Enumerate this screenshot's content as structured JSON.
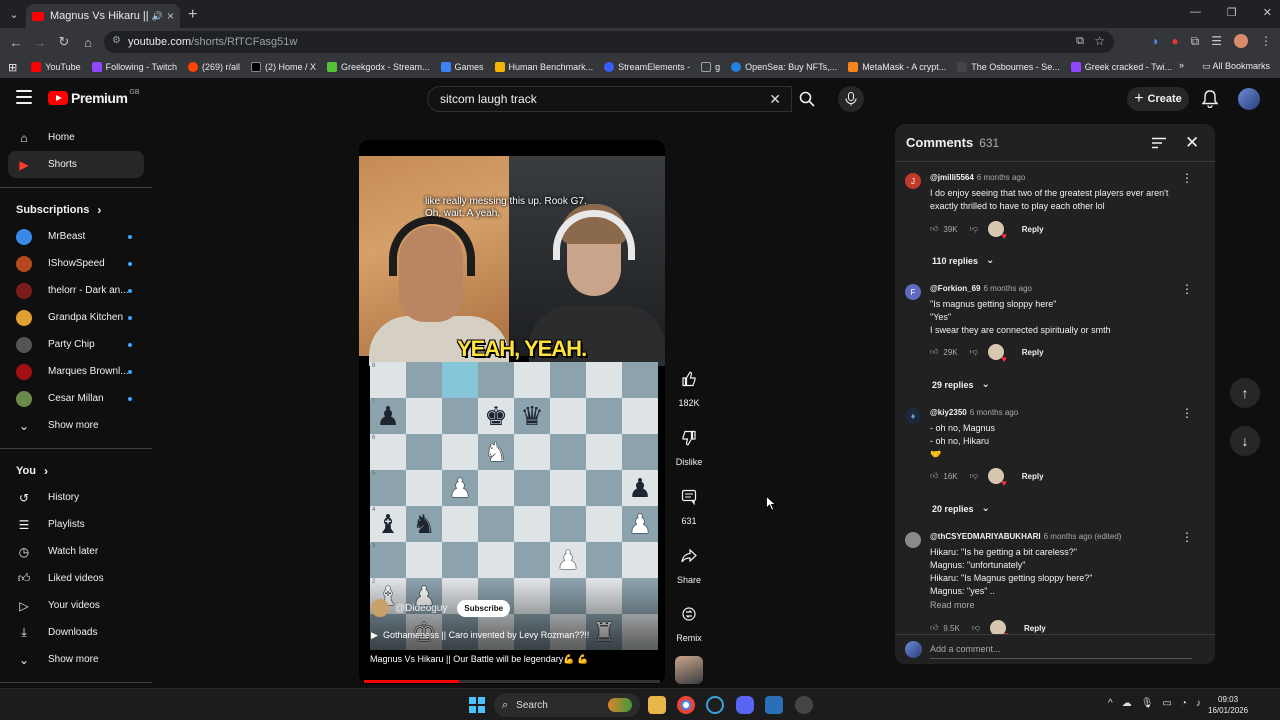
{
  "browser": {
    "tab_title": "Magnus Vs Hikaru || Our Ba",
    "url_domain": "youtube.com",
    "url_path": "/shorts/RfTCFasg51w",
    "bookmarks": [
      {
        "label": "YouTube",
        "color": "#ff0000"
      },
      {
        "label": "Following - Twitch",
        "color": "#9146ff"
      },
      {
        "label": "(269) r/all",
        "color": "#ff4500"
      },
      {
        "label": "(2) Home / X",
        "color": "#e8eaed"
      },
      {
        "label": "Greekgodx - Stream...",
        "color": "#53c43a"
      },
      {
        "label": "Games",
        "color": "#3b82f6"
      },
      {
        "label": "Human Benchmark...",
        "color": "#f5b400"
      },
      {
        "label": "StreamElements -",
        "color": "#3a5bff"
      },
      {
        "label": "g",
        "color": "#9aa0a6"
      },
      {
        "label": "OpenSea: Buy NFTs,...",
        "color": "#2081e2"
      },
      {
        "label": "MetaMask - A crypt...",
        "color": "#f6851b"
      },
      {
        "label": "The Osbournes - Se...",
        "color": "#444444"
      },
      {
        "label": "Greek cracked - Twi...",
        "color": "#9146ff"
      }
    ],
    "all_bookmarks": "All Bookmarks"
  },
  "header": {
    "logo_text": "Premium",
    "region": "GB",
    "search_value": "sitcom laugh track",
    "create_label": "Create"
  },
  "sidebar": {
    "main": [
      {
        "label": "Home",
        "icon": "home-icon"
      },
      {
        "label": "Shorts",
        "icon": "shorts-icon"
      }
    ],
    "subscriptions_title": "Subscriptions",
    "subscriptions": [
      {
        "label": "MrBeast",
        "color": "#3a88e8"
      },
      {
        "label": "IShowSpeed",
        "color": "#b5471f"
      },
      {
        "label": "thelorr - Dark an...",
        "color": "#7a1a1a"
      },
      {
        "label": "Grandpa Kitchen",
        "color": "#e0a030"
      },
      {
        "label": "Party Chip",
        "color": "#555555"
      },
      {
        "label": "Marques Brownl...",
        "color": "#a01010"
      },
      {
        "label": "Cesar Millan",
        "color": "#6a8a4a"
      }
    ],
    "show_more": "Show more",
    "you_title": "You",
    "you": [
      {
        "label": "History",
        "icon": "history-icon"
      },
      {
        "label": "Playlists",
        "icon": "playlists-icon"
      },
      {
        "label": "Watch later",
        "icon": "watch-later-icon"
      },
      {
        "label": "Liked videos",
        "icon": "liked-videos-icon"
      },
      {
        "label": "Your videos",
        "icon": "your-videos-icon"
      },
      {
        "label": "Downloads",
        "icon": "downloads-icon"
      }
    ],
    "show_more_2": "Show more"
  },
  "video": {
    "caption_line1": "like really messing this up. Rook G7.",
    "caption_line2": "Oh, wait. A yeah,",
    "overlay_text": "YEAH, YEAH.",
    "channel": "@Dideoguy",
    "subscribe": "Subscribe",
    "related": "Gothameness || Caro invented by Levy Rozman??!!",
    "title": "Magnus Vs Hikaru || Our Battle will be legendary💪 💪",
    "progress_fraction": 0.32,
    "board": [
      [
        "",
        "",
        "h",
        "",
        "",
        "",
        "",
        ""
      ],
      [
        "p",
        "",
        "",
        "k",
        "q",
        "",
        "",
        ""
      ],
      [
        "",
        "",
        "",
        "N",
        "",
        "",
        "",
        ""
      ],
      [
        "",
        "",
        "P",
        "",
        "",
        "",
        "",
        "p"
      ],
      [
        "b",
        "n",
        "",
        "",
        "",
        "",
        "",
        "P"
      ],
      [
        "",
        "",
        "",
        "",
        "",
        "P",
        "",
        ""
      ],
      [
        "B",
        "P",
        "",
        "",
        "",
        "",
        "",
        ""
      ],
      [
        "",
        "K",
        "",
        "",
        "",
        "",
        "R",
        ""
      ]
    ]
  },
  "actions": {
    "like_count": "182K",
    "dislike_label": "Dislike",
    "comments_count": "631",
    "share_label": "Share",
    "remix_label": "Remix"
  },
  "comments": {
    "title": "Comments",
    "count": "631",
    "items": [
      {
        "user": "@jmilli5564",
        "time": "6 months ago",
        "avatar_letter": "J",
        "avatar_color": "#c0392b",
        "lines": [
          "I do enjoy seeing that two of the greatest players ever aren't",
          "exactly thrilled to have to play each other lol"
        ],
        "likes": "39K",
        "reply": "Reply",
        "replies": "110 replies"
      },
      {
        "user": "@Forkion_69",
        "time": "6 months ago",
        "avatar_letter": "F",
        "avatar_color": "#5c6bc0",
        "lines": [
          "\"Is magnus getting sloppy here\"",
          "\"Yes\"",
          "I swear they are connected spiritually or smth"
        ],
        "likes": "29K",
        "reply": "Reply",
        "replies": "29 replies"
      },
      {
        "user": "@kiy2350",
        "time": "6 months ago",
        "avatar_letter": "",
        "avatar_color": "#1a2a3a",
        "lines": [
          "- oh no, Magnus",
          "- oh no, Hikaru",
          "🤝"
        ],
        "likes": "16K",
        "reply": "Reply",
        "replies": "20 replies"
      },
      {
        "user": "@thCSYEDMARIYABUKHARI",
        "time": "6 months ago (edited)",
        "avatar_letter": "",
        "avatar_color": "#8a8a8a",
        "lines": [
          "Hikaru: \"Is he getting a bit careless?\"",
          "Magnus: \"unfortunately\"",
          "Hikaru: \"Is Magnus getting sloppy here?\"",
          "Magnus: \"yes\" .."
        ],
        "read_more": "Read more",
        "likes": "9.5K",
        "reply": "Reply"
      }
    ],
    "add_placeholder": "Add a comment..."
  },
  "taskbar": {
    "search": "Search",
    "time": "09:03",
    "date": "16/01/2026"
  }
}
